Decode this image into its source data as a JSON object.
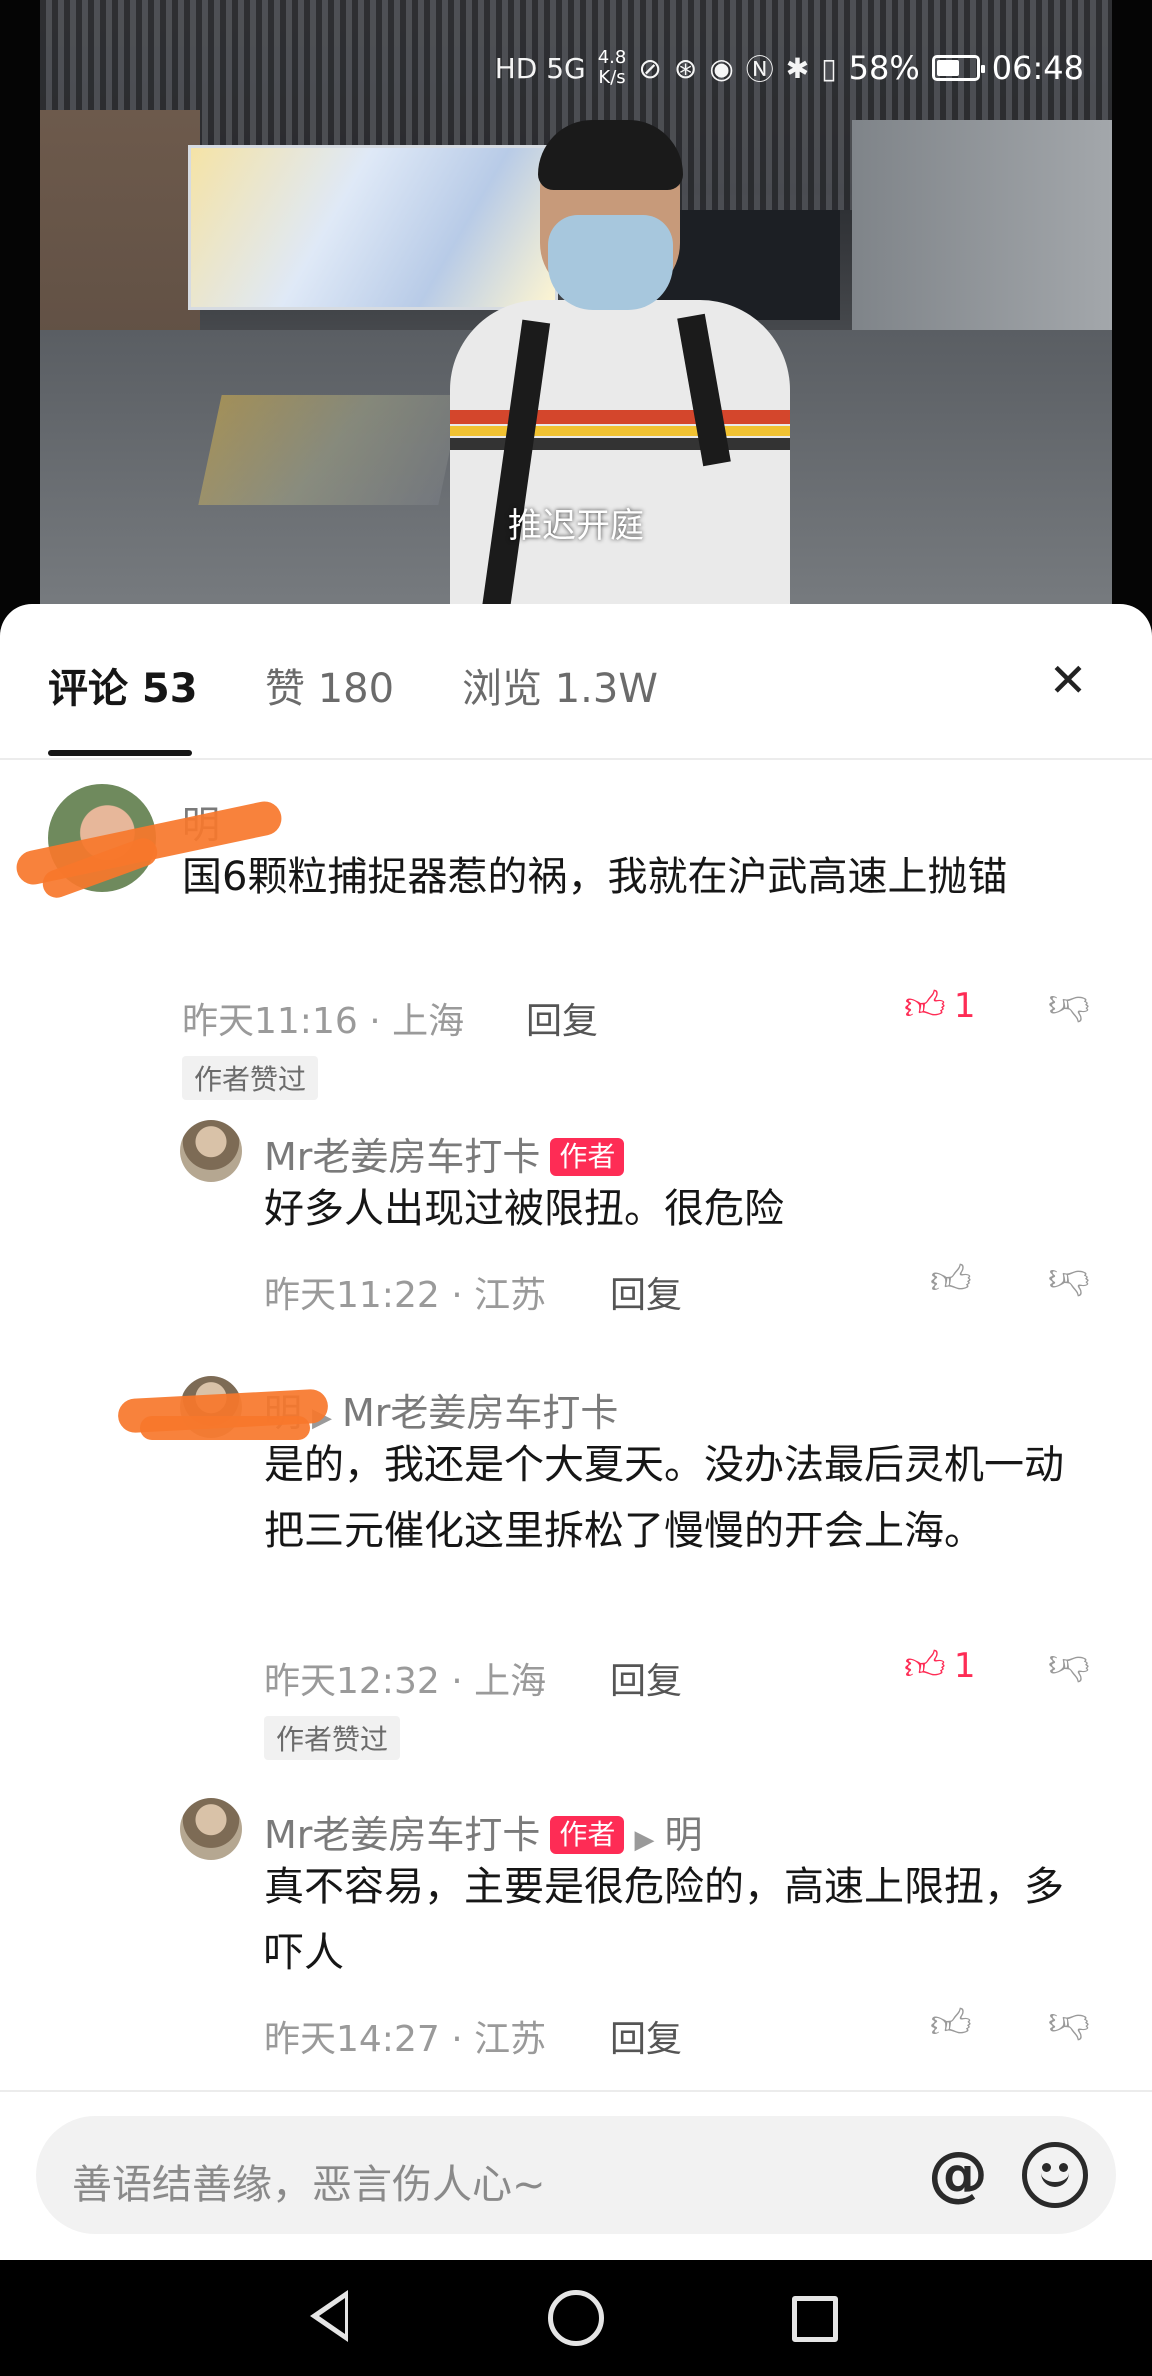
{
  "status_bar": {
    "network": "HD 5G",
    "speed_value": "4.8",
    "speed_unit": "K/s",
    "battery": "58%",
    "battery_level": 0.58,
    "time": "06:48"
  },
  "video": {
    "subtitle": "推迟开庭"
  },
  "tabs": [
    {
      "label": "评论 53",
      "active": true
    },
    {
      "label": "赞 180",
      "active": false
    },
    {
      "label": "浏览 1.3W",
      "active": false
    }
  ],
  "comments": {
    "c1": {
      "name": "明",
      "text": "国6颗粒捕捉器惹的祸，我就在沪武高速上抛锚",
      "time": "昨天11:16",
      "location": "上海",
      "reply_label": "回复",
      "likes": "1",
      "author_liked": "作者赞过"
    },
    "r1": {
      "name": "Mr老姜房车打卡",
      "badge": "作者",
      "text": "好多人出现过被限扭。很危险",
      "time": "昨天11:22",
      "location": "江苏",
      "reply_label": "回复"
    },
    "r2": {
      "name": "明",
      "reply_to": "Mr老姜房车打卡",
      "text": "是的，我还是个大夏天。没办法最后灵机一动把三元催化这里拆松了慢慢的开会上海。",
      "time": "昨天12:32",
      "location": "上海",
      "reply_label": "回复",
      "likes": "1",
      "author_liked": "作者赞过"
    },
    "r3": {
      "name": "Mr老姜房车打卡",
      "badge": "作者",
      "reply_to": "明",
      "text": "真不容易，主要是很危险的，高速上限扭，多吓人",
      "time": "昨天14:27",
      "location": "江苏",
      "reply_label": "回复"
    }
  },
  "meta_separator": "·",
  "input": {
    "placeholder": "善语结善缘，恶言伤人心~",
    "at_symbol": "@"
  },
  "icons": {
    "like": "thumbs-up-icon",
    "dislike": "thumbs-down-icon",
    "close": "close-icon",
    "emoji": "emoji-icon",
    "triangle": "reply-arrow-icon"
  },
  "colors": {
    "accent": "#fe2c55",
    "text": "#161616",
    "meta": "#9a9a9a"
  }
}
